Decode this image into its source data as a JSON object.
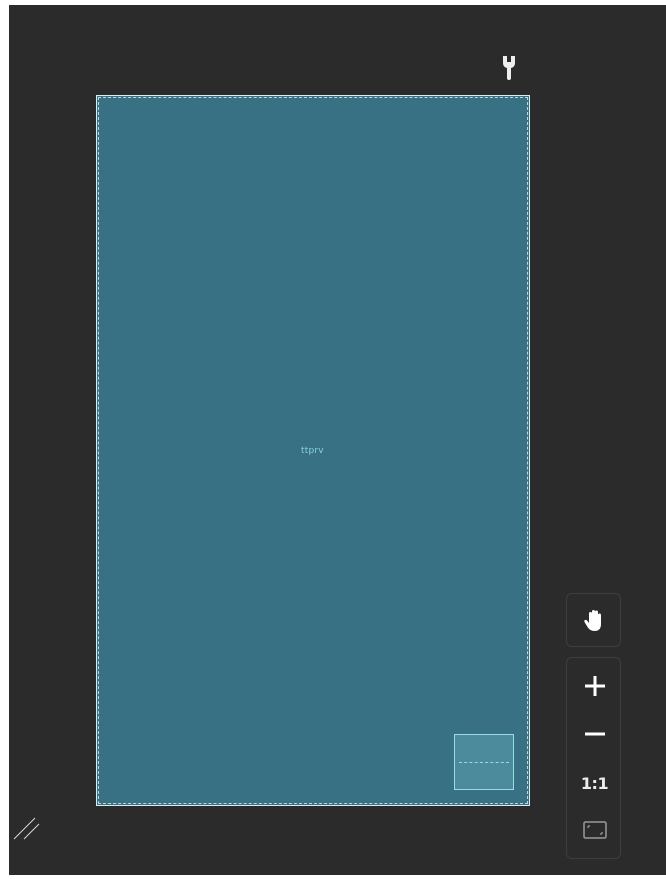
{
  "canvas": {
    "frame_label": "ttprv"
  },
  "toolbar": {
    "zoom_reset_label": "1:1"
  },
  "icons": {
    "settings": "wrench-icon",
    "pan": "hand-icon",
    "zoom_in": "plus-icon",
    "zoom_out": "minus-icon",
    "fit": "fit-screen-icon",
    "resize": "resize-grip-icon"
  },
  "colors": {
    "workspace_background": "#2b2b2c",
    "frame_fill": "#387184",
    "frame_border": "#d7eef3",
    "frame_label": "#84d2e6",
    "mini_frame_fill": "#4b8b9b"
  }
}
